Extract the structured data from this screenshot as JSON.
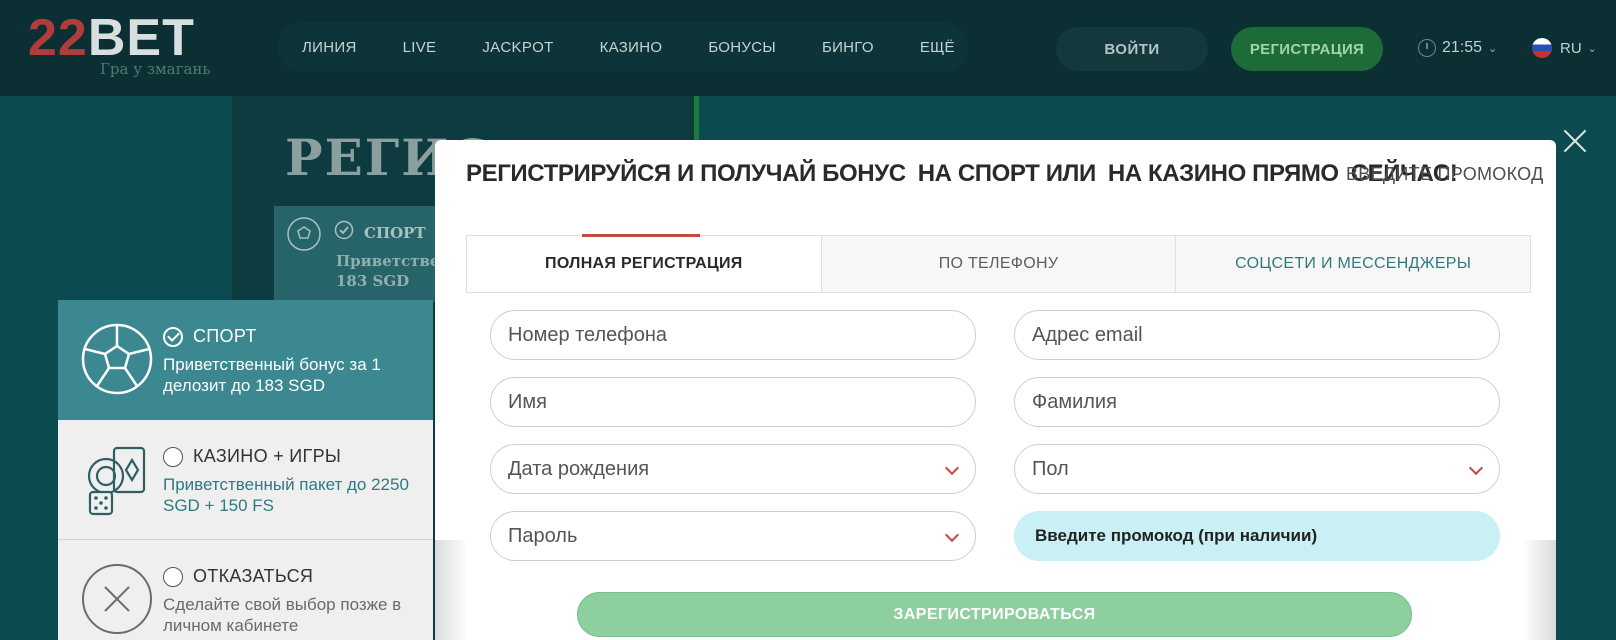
{
  "header": {
    "logo": {
      "number": "22",
      "brand": "BET",
      "tagline": "Гра у змагань"
    },
    "nav": [
      "ЛИНИЯ",
      "LIVE",
      "JACKPOT",
      "КАЗИНО",
      "БОНУСЫ",
      "БИНГО",
      "ЕЩЁ"
    ],
    "login_label": "ВОЙТИ",
    "register_label": "РЕГИСТРАЦИЯ",
    "time": "21:55",
    "language": "RU"
  },
  "background": {
    "title": "РЕГИС",
    "card_label": "СПОРТ",
    "card_text_line1": "Приветственн",
    "card_text_line2": "183 SGD"
  },
  "bonus_options": [
    {
      "title": "СПОРТ",
      "description": "Приветственный бонус за 1 делозит до 183 SGD",
      "selected": true,
      "icon": "soccer-ball-icon"
    },
    {
      "title": "КАЗИНО + ИГРЫ",
      "description": "Приветственный пакет до 2250 SGD + 150 FS",
      "selected": false,
      "icon": "casino-chips-cards-icon"
    },
    {
      "title": "ОТКАЗАТЬСЯ",
      "description": "Сделайте свой выбор позже в личном кабинете",
      "selected": false,
      "icon": "decline-x-icon"
    }
  ],
  "modal": {
    "headline": [
      "РЕГИСТРИРУЙСЯ И ПОЛУЧАЙ БОНУС",
      "НА СПОРТ ИЛИ",
      "НА КАЗИНО ПРЯМО",
      "СЕЙЧАС!"
    ],
    "promo_link": "ВВЕДИТЕ ПРОМОКОД",
    "tabs": [
      "ПОЛНАЯ РЕГИСТРАЦИЯ",
      "ПО ТЕЛЕФОНУ",
      "СОЦСЕТИ И МЕССЕНДЖЕРЫ"
    ],
    "fields": {
      "phone_placeholder": "Номер телефона",
      "email_placeholder": "Адрес email",
      "first_name_placeholder": "Имя",
      "last_name_placeholder": "Фамилия",
      "birthdate_placeholder": "Дата рождения",
      "gender_placeholder": "Пол",
      "password_placeholder": "Пароль",
      "promo_placeholder": "Введите промокод (при наличии)"
    },
    "submit_label": "ЗАРЕГИСТРИРОВАТЬСЯ"
  },
  "colors": {
    "header_bg": "#0c2f33",
    "page_bg": "#0b4b4f",
    "accent_green": "#1d6b38",
    "accent_red": "#c24a44",
    "selected_option": "#3b8890",
    "promo_field": "#c9f1f5",
    "submit_bg": "#8ecfa0"
  }
}
